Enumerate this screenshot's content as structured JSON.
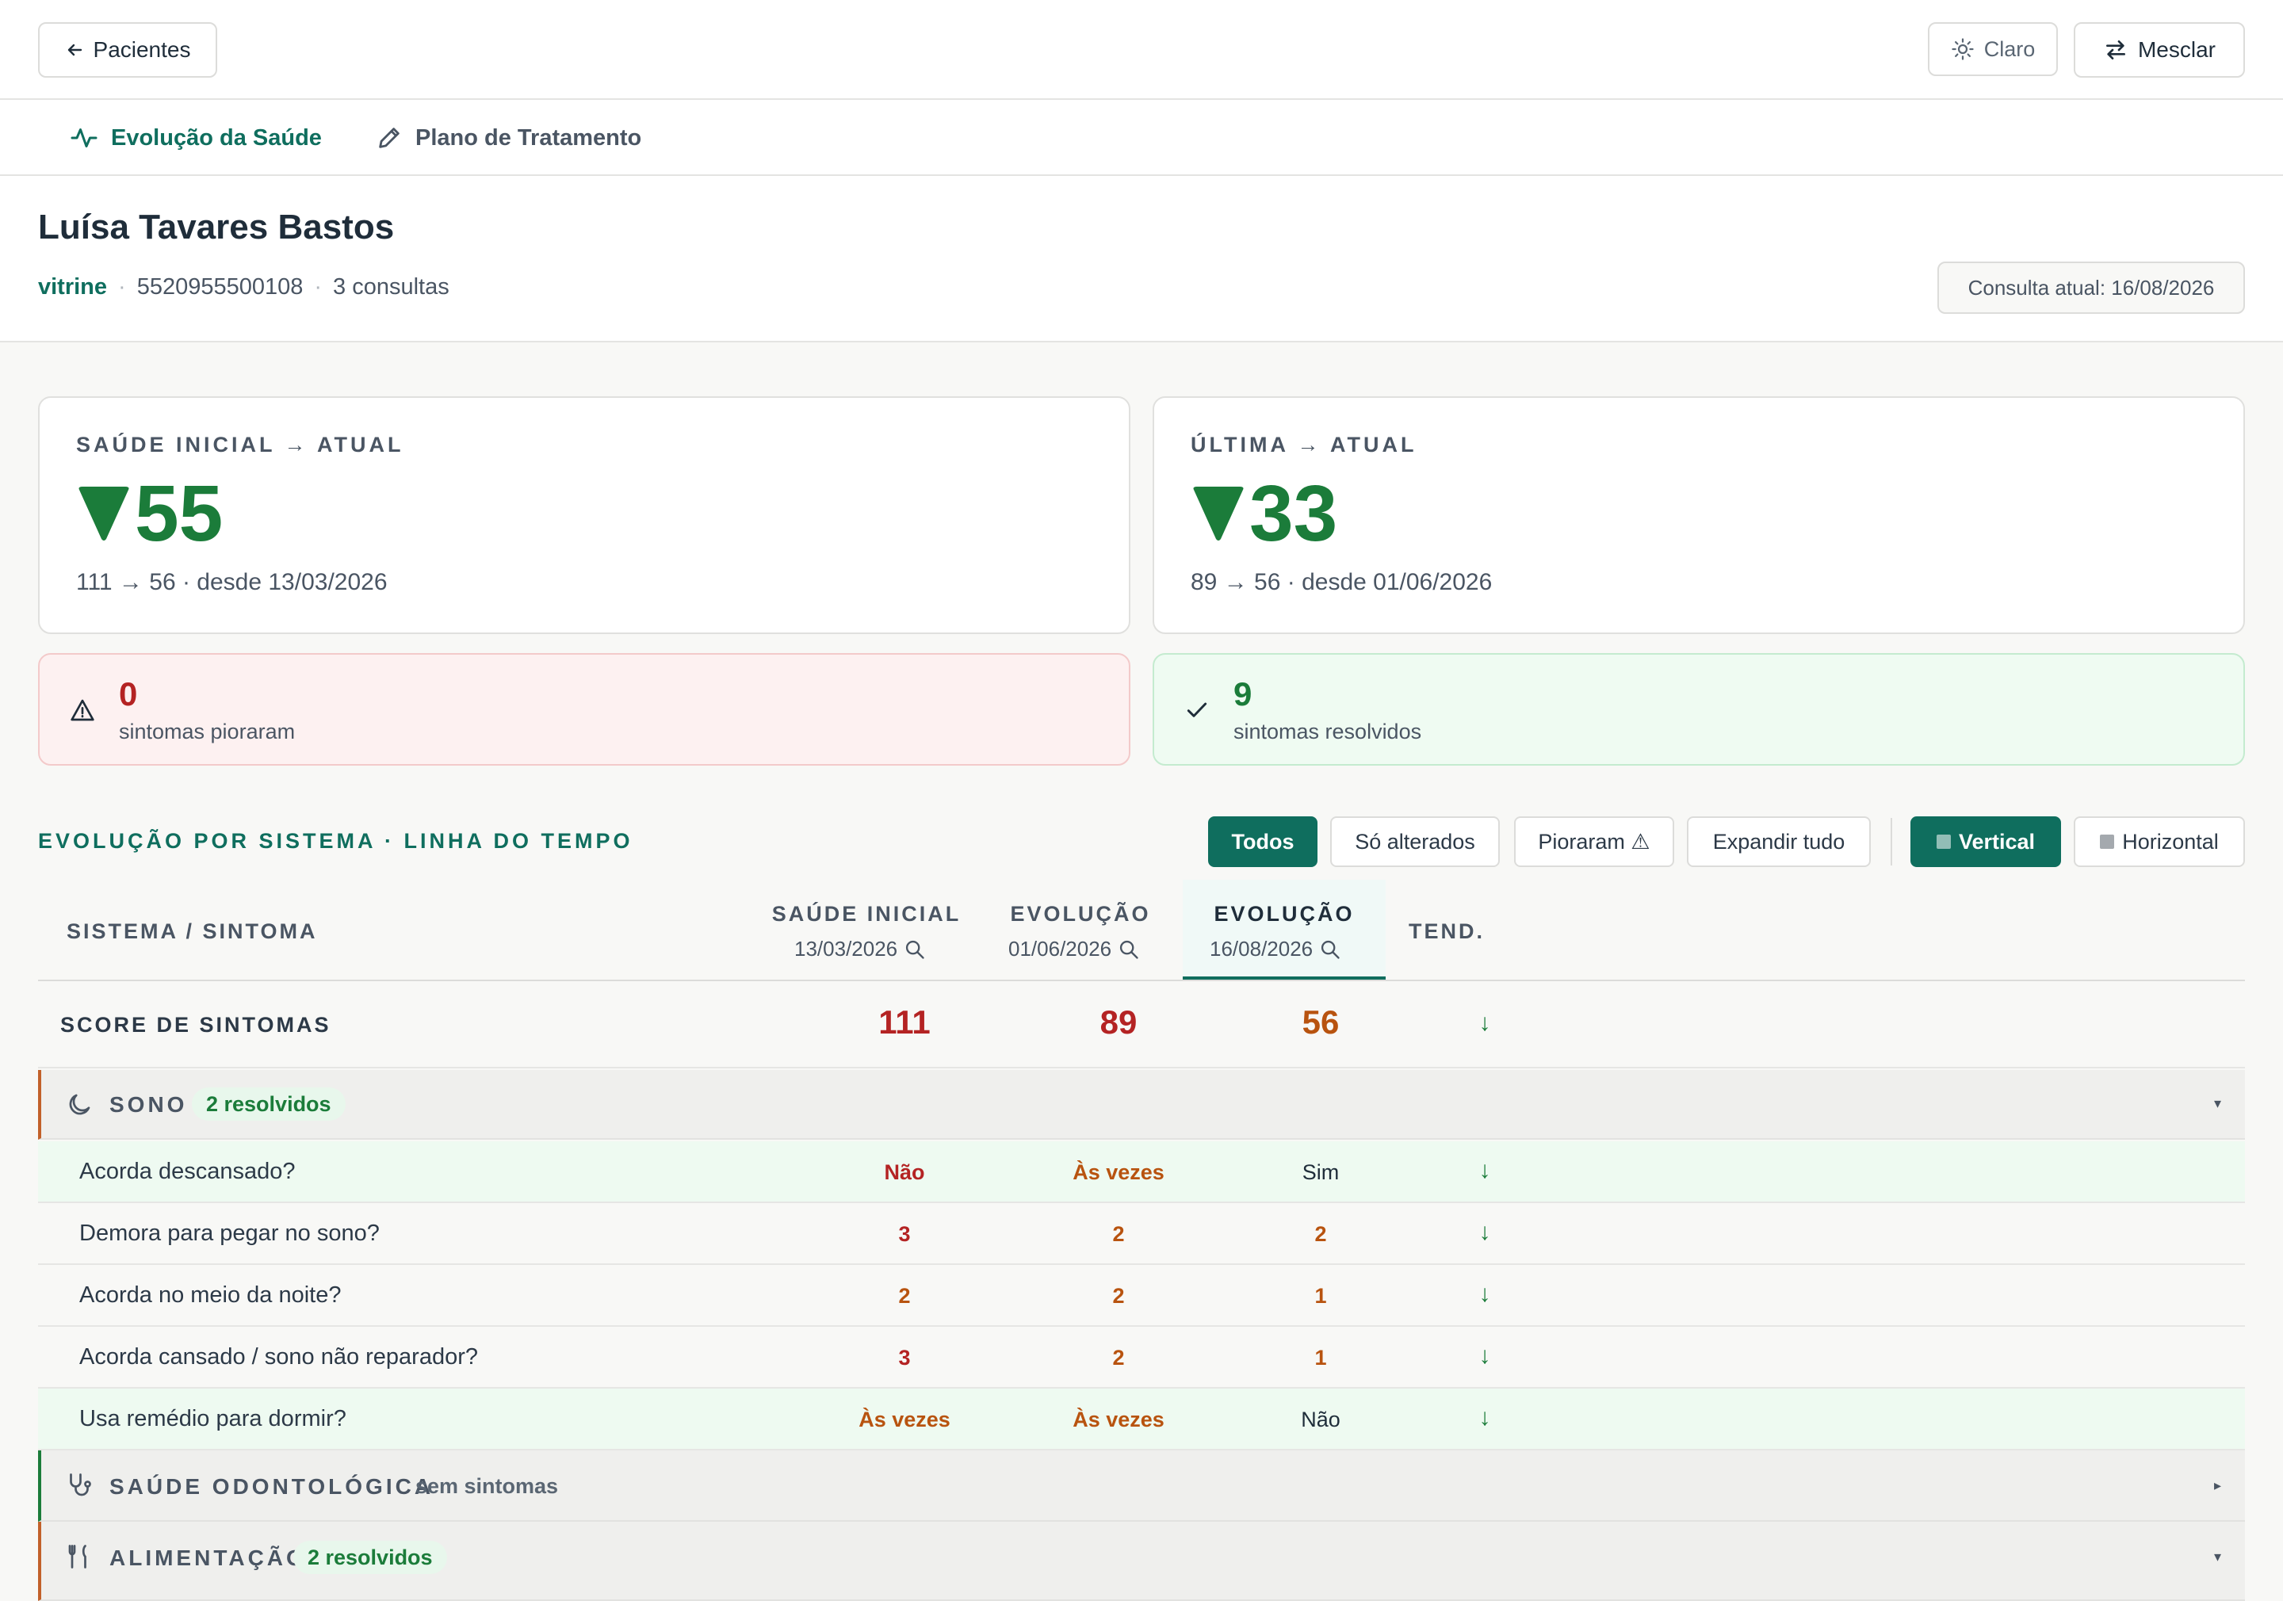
{
  "topbar": {
    "back_label": "Pacientes",
    "theme_label": "Claro",
    "merge_label": "Mesclar"
  },
  "tabs": [
    {
      "label": "Evolução da Saúde",
      "active": true
    },
    {
      "label": "Plano de Tratamento",
      "active": false
    }
  ],
  "patient": {
    "name": "Luísa Tavares Bastos",
    "source": "vitrine",
    "phone": "5520955500108",
    "consults": "3 consultas",
    "current_consult": "Consulta atual: 16/08/2026"
  },
  "cards": [
    {
      "label": "SAÚDE INICIAL → ATUAL",
      "value": "55",
      "sub": "111 → 56 · desde 13/03/2026"
    },
    {
      "label": "ÚLTIMA → ATUAL",
      "value": "33",
      "sub": "89 → 56 · desde 01/06/2026"
    }
  ],
  "alerts": {
    "worse": {
      "count": "0",
      "label": "sintomas pioraram"
    },
    "resolved": {
      "count": "9",
      "label": "sintomas resolvidos"
    }
  },
  "section": {
    "title": "EVOLUÇÃO POR SISTEMA · LINHA DO TEMPO",
    "filters": [
      "Todos",
      "Só alterados",
      "Pioraram ⚠",
      "Expandir tudo"
    ],
    "views": [
      "Vertical",
      "Horizontal"
    ]
  },
  "table": {
    "col_system": "SISTEMA / SINTOMA",
    "col_tend": "TEND.",
    "columns": [
      {
        "title": "SAÚDE INICIAL",
        "date": "13/03/2026"
      },
      {
        "title": "EVOLUÇÃO",
        "date": "01/06/2026"
      },
      {
        "title": "EVOLUÇÃO",
        "date": "16/08/2026"
      }
    ],
    "score": {
      "label": "SCORE DE SINTOMAS",
      "values": [
        "111",
        "89",
        "56"
      ],
      "trend": "↓"
    },
    "groups": [
      {
        "name": "SONO",
        "badge": "2 resolvidos",
        "caret": "▾"
      },
      {
        "name": "SAÚDE ODONTOLÓGICA",
        "badge": "sem sintomas",
        "caret": "▸"
      },
      {
        "name": "ALIMENTAÇÃO",
        "badge": "2 resolvidos",
        "caret": "▾"
      }
    ],
    "sono_rows": [
      {
        "label": "Acorda descansado?",
        "values": [
          "Não",
          "Às vezes",
          "Sim"
        ]
      },
      {
        "label": "Demora para pegar no sono?",
        "values": [
          "3",
          "2",
          "2"
        ]
      },
      {
        "label": "Acorda no meio da noite?",
        "values": [
          "2",
          "2",
          "1"
        ]
      },
      {
        "label": "Acorda cansado / sono não reparador?",
        "values": [
          "3",
          "2",
          "1"
        ]
      },
      {
        "label": "Usa remédio para dormir?",
        "values": [
          "Às vezes",
          "Às vezes",
          "Não"
        ]
      }
    ]
  },
  "colors": {
    "accent": "#0f6e5e",
    "good": "#1b7c3a",
    "bad": "#b42323",
    "warn": "#b8530f"
  }
}
